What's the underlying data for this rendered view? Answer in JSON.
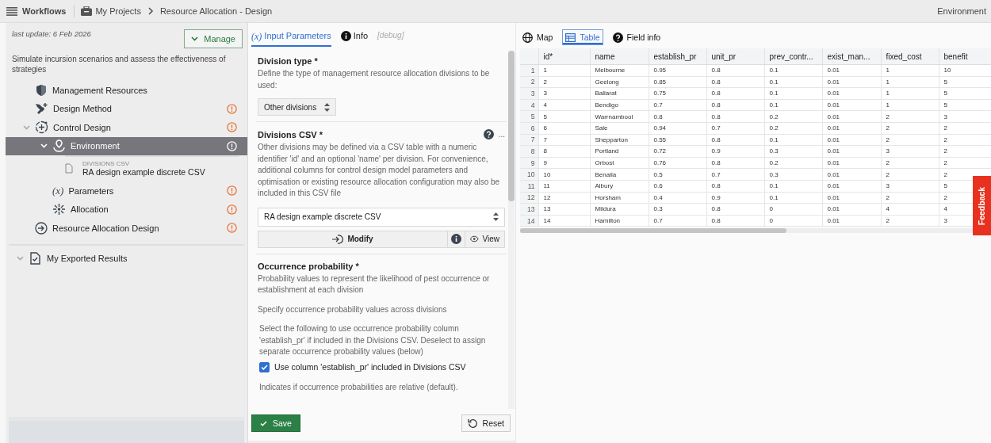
{
  "topbar": {
    "menu": "Workflows",
    "breadcrumbs": [
      {
        "label": "My Projects",
        "kind": "projects"
      },
      {
        "label": "Resource Allocation - Design",
        "kind": "page"
      }
    ],
    "right": "Environment"
  },
  "sidebar": {
    "last_update": "last update: 6 Feb 2026",
    "manage": "Manage",
    "description": "Simulate incursion scenarios and assess the effectiveness of strategies",
    "tree": [
      {
        "label": "Management Resources",
        "kind": "resources",
        "warning": false,
        "selected": false
      },
      {
        "label": "Design Method",
        "kind": "method",
        "warning": true,
        "selected": false
      },
      {
        "label": "Control Design",
        "kind": "design",
        "warning": true,
        "selected": false,
        "expanded": true,
        "children": [
          {
            "label": "Environment",
            "kind": "environment",
            "warning": true,
            "selected": true,
            "expanded": true,
            "children": [
              {
                "label": "RA design example discrete CSV",
                "caption": "DIVISIONS CSV",
                "kind": "file",
                "selected": false
              }
            ]
          },
          {
            "label": "Parameters",
            "kind": "parameters",
            "icon_text": "(x)",
            "warning": true,
            "selected": false
          },
          {
            "label": "Allocation",
            "kind": "allocation",
            "warning": true,
            "selected": false
          }
        ]
      },
      {
        "label": "Resource Allocation Design",
        "kind": "output",
        "warning": true,
        "selected": false
      }
    ],
    "exported": {
      "label": "My Exported Results"
    }
  },
  "form": {
    "tabs": [
      {
        "label": "Input Parameters",
        "kind": "params",
        "icon_text": "(x)",
        "selected": true
      },
      {
        "label": "Info",
        "kind": "info",
        "selected": false
      },
      {
        "label": "[debug]",
        "kind": "debug",
        "selected": false
      }
    ],
    "division_type": {
      "title": "Division type",
      "required": "*",
      "description": "Define the type of management resource allocation divisions to be used:",
      "value": "Other divisions"
    },
    "divisions_csv": {
      "title": "Divisions CSV",
      "required": "*",
      "more": "...",
      "description": "Other divisions may be defined via a CSV table with a numeric identifier 'id' and an optional 'name' per division. For convenience, additional columns for control design model parameters and optimisation or existing resource allocation configuration may also be included in this CSV file",
      "value": "RA design example discrete CSV",
      "modify": "Modify",
      "view": "View"
    },
    "occurrence": {
      "title": "Occurrence probability",
      "required": "*",
      "description": "Probability values to represent the likelihood of pest occurrence or establishment at each division",
      "subtitle": "Specify occurrence probability values across divisions",
      "hint": "Select the following to use occurrence probability column 'establish_pr' if included in the Divisions CSV. Deselect to assign separate occurrence probability values (below)",
      "checkbox": {
        "label": "Use column 'establish_pr' included in Divisions CSV",
        "checked": true
      },
      "note": "Indicates if occurrence probabilities are relative (default)."
    },
    "save": "Save",
    "reset": "Reset"
  },
  "viewer": {
    "tabs": [
      {
        "label": "Map",
        "kind": "map",
        "selected": false
      },
      {
        "label": "Table",
        "kind": "table",
        "selected": true
      },
      {
        "label": "Field info",
        "kind": "help",
        "selected": false
      }
    ],
    "table": {
      "columns": [
        "id*",
        "name",
        "establish_pr",
        "unit_pr",
        "prev_contr...",
        "exist_man...",
        "fixed_cost",
        "benefit"
      ],
      "rows": [
        {
          "num": "1",
          "cells": [
            "1",
            "Melbourne",
            "0.95",
            "0.8",
            "0.1",
            "0.01",
            "1",
            "10"
          ]
        },
        {
          "num": "2",
          "cells": [
            "2",
            "Geelong",
            "0.85",
            "0.8",
            "0.1",
            "0.01",
            "1",
            "5"
          ]
        },
        {
          "num": "3",
          "cells": [
            "3",
            "Ballarat",
            "0.75",
            "0.8",
            "0.1",
            "0.01",
            "1",
            "5"
          ]
        },
        {
          "num": "4",
          "cells": [
            "4",
            "Bendigo",
            "0.7",
            "0.8",
            "0.1",
            "0.01",
            "1",
            "5"
          ]
        },
        {
          "num": "5",
          "cells": [
            "5",
            "Warrnambool",
            "0.8",
            "0.8",
            "0.2",
            "0.01",
            "2",
            "3"
          ]
        },
        {
          "num": "6",
          "cells": [
            "6",
            "Sale",
            "0.94",
            "0.7",
            "0.2",
            "0.01",
            "2",
            "2"
          ]
        },
        {
          "num": "7",
          "cells": [
            "7",
            "Shepparton",
            "0.55",
            "0.8",
            "0.1",
            "0.01",
            "2",
            "2"
          ]
        },
        {
          "num": "8",
          "cells": [
            "8",
            "Portland",
            "0.72",
            "0.9",
            "0.3",
            "0.01",
            "3",
            "2"
          ]
        },
        {
          "num": "9",
          "cells": [
            "9",
            "Orbost",
            "0.76",
            "0.8",
            "0.2",
            "0.01",
            "2",
            "2"
          ]
        },
        {
          "num": "10",
          "cells": [
            "10",
            "Benalla",
            "0.5",
            "0.7",
            "0.3",
            "0.01",
            "2",
            "2"
          ]
        },
        {
          "num": "11",
          "cells": [
            "11",
            "Albury",
            "0.6",
            "0.8",
            "0.1",
            "0.01",
            "3",
            "5"
          ]
        },
        {
          "num": "12",
          "cells": [
            "12",
            "Horsham",
            "0.4",
            "0.9",
            "0.1",
            "0.01",
            "2",
            "2"
          ]
        },
        {
          "num": "13",
          "cells": [
            "13",
            "Mildura",
            "0.3",
            "0.8",
            "0",
            "0.01",
            "4",
            "4"
          ]
        },
        {
          "num": "14",
          "cells": [
            "14",
            "Hamilton",
            "0.7",
            "0.8",
            "0",
            "0.01",
            "2",
            "3"
          ]
        }
      ]
    }
  },
  "feedback": "Feedback"
}
